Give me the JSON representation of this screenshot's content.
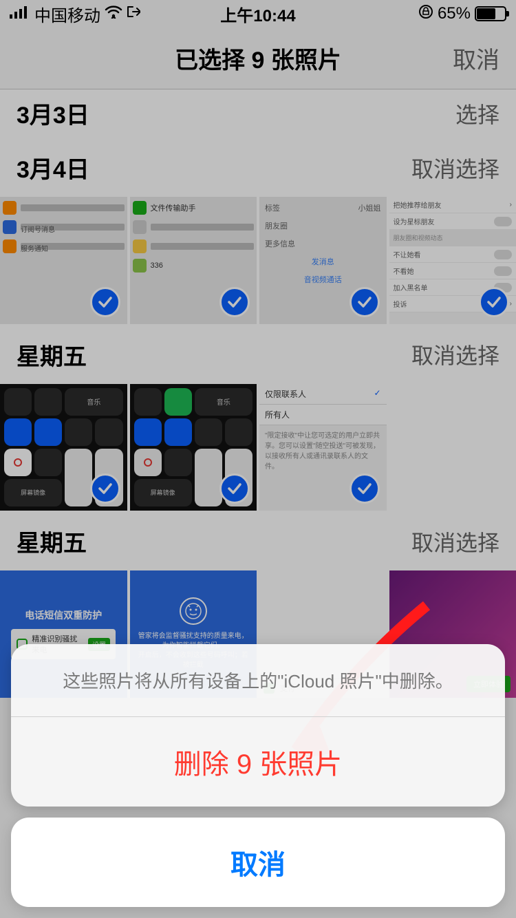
{
  "status": {
    "carrier": "中国移动",
    "time": "上午10:44",
    "battery_pct": "65%"
  },
  "nav": {
    "title": "已选择 9 张照片",
    "cancel": "取消"
  },
  "sections": [
    {
      "date": "3月3日",
      "action": "选择"
    },
    {
      "date": "3月4日",
      "action": "取消选择"
    },
    {
      "date": "星期五",
      "action": "取消选择"
    },
    {
      "date": "星期五",
      "action": "取消选择"
    }
  ],
  "sheet": {
    "message": "这些照片将从所有设备上的\"iCloud 照片\"中删除。",
    "delete": "删除 9 张照片",
    "cancel": "取消"
  },
  "thumb_labels": {
    "file_helper": "文件传输助手",
    "tags": "标签",
    "moments": "朋友圈",
    "more_info": "更多信息",
    "send_msg": "发消息",
    "video_call": "音视频通话",
    "recommend": "把她推荐给朋友",
    "star": "设为星标朋友",
    "block_moments": "不让她看",
    "hide_moments": "不看她",
    "blacklist": "加入黑名单",
    "report": "投诉",
    "contacts_only": "仅限联系人",
    "everyone": "所有人",
    "phone_protect": "电话短信双重防护",
    "precise_block": "精准识别骚扰来电",
    "subscribe": "订阅号消息",
    "service": "服务通知"
  }
}
